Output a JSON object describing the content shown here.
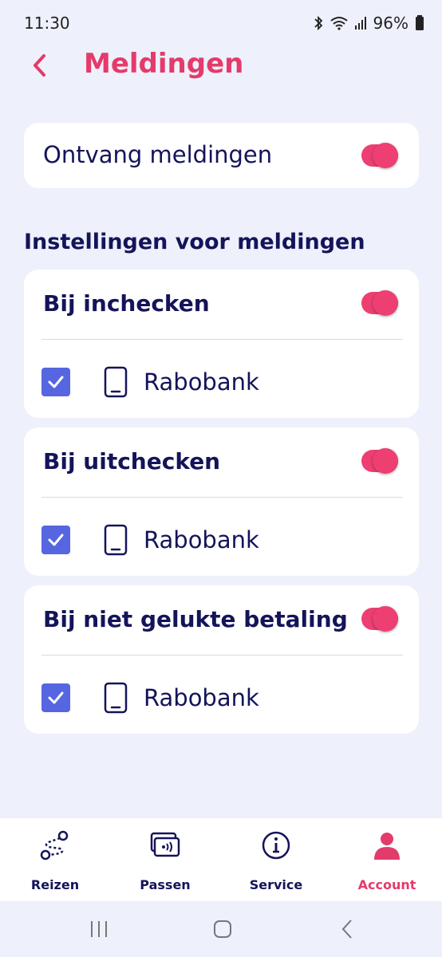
{
  "status_bar": {
    "time": "11:30",
    "battery": "96%"
  },
  "header": {
    "title": "Meldingen"
  },
  "main_toggle": {
    "label": "Ontvang meldingen",
    "on": true
  },
  "section": {
    "title": "Instellingen voor meldingen"
  },
  "cards": [
    {
      "title": "Bij inchecken",
      "on": true,
      "device": "Rabobank",
      "checked": true
    },
    {
      "title": "Bij uitchecken",
      "on": true,
      "device": "Rabobank",
      "checked": true
    },
    {
      "title": "Bij niet gelukte betaling",
      "on": true,
      "device": "Rabobank",
      "checked": true
    }
  ],
  "bottom_nav": [
    {
      "label": "Reizen",
      "icon": "route-icon",
      "active": false
    },
    {
      "label": "Passen",
      "icon": "cards-icon",
      "active": false
    },
    {
      "label": "Service",
      "icon": "info-icon",
      "active": false
    },
    {
      "label": "Account",
      "icon": "user-icon",
      "active": true
    }
  ],
  "colors": {
    "accent": "#e33b6b",
    "toggle": "#ed3f72",
    "checkbox": "#5566e0",
    "text": "#14145a",
    "background": "#eef0fb"
  }
}
